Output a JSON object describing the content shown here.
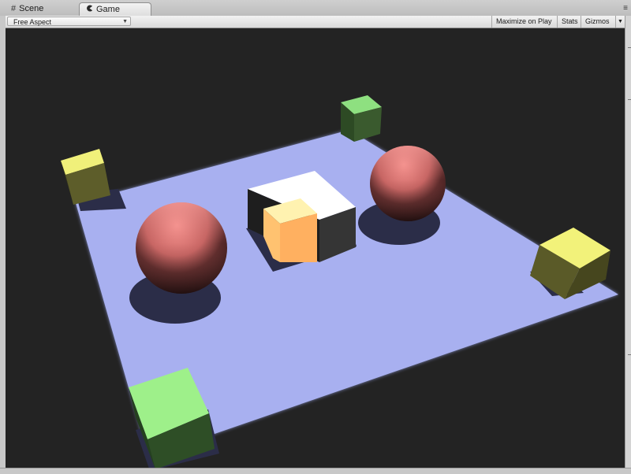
{
  "tabs": [
    {
      "label": "Scene",
      "icon": "grid-icon"
    },
    {
      "label": "Game",
      "icon": "pacman-icon"
    }
  ],
  "toolbar": {
    "aspect": "Free Aspect",
    "maximize_label": "Maximize on Play",
    "stats_label": "Stats",
    "gizmos_label": "Gizmos"
  },
  "scene": {
    "background_color": "#232323",
    "floor_color": "#a8b0f0",
    "sphere_color": "#e07a78",
    "center_box_color": "#ffffff",
    "corner_cube_colors": [
      "#f0f07a",
      "#8ee080",
      "#f2f27a",
      "#9ef08a"
    ],
    "objects": [
      "floor-plane",
      "left-sphere",
      "right-sphere",
      "center-box",
      "corner-cube-back-left",
      "corner-cube-back",
      "corner-cube-right",
      "corner-cube-front"
    ]
  }
}
